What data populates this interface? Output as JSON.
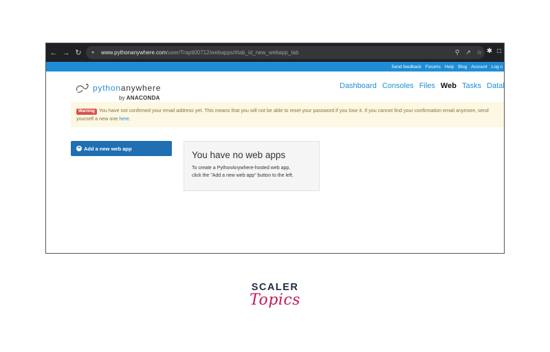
{
  "browser": {
    "url_host": "www.pythonanywhere.com",
    "url_path": "/user/Trapti00712/webapps/#tab_id_new_webapp_tab",
    "nav_icons": [
      "back-arrow-icon",
      "forward-arrow-icon",
      "reload-icon"
    ],
    "omnibox_icons": [
      "zoom-icon",
      "share-icon",
      "bookmark-star-icon"
    ],
    "extension_icons": [
      "puzzle-icon",
      "sidebar-icon"
    ]
  },
  "topbar": {
    "links": [
      "Send feedback",
      "Forums",
      "Help",
      "Blog",
      "Account",
      "Log o"
    ]
  },
  "logo": {
    "part1": "python",
    "part2": "anywhere",
    "by": "by",
    "company": "ANACONDA"
  },
  "nav": {
    "items": [
      "Dashboard",
      "Consoles",
      "Files",
      "Web",
      "Tasks",
      "Databases"
    ],
    "active": "Web"
  },
  "warning": {
    "badge": "Warning",
    "text": "You have not confirmed your email address yet. This means that you will not be able to reset your password if you lose it. If you cannot find your confirmation email anymore, send yourself a new one ",
    "link": "here",
    "end": "."
  },
  "add_button": {
    "label": "Add a new web app"
  },
  "empty": {
    "title": "You have no web apps",
    "line1": "To create a PythonAnywhere-hosted web app,",
    "line2": "click the \"Add a new web app\" button to the left."
  },
  "brand": {
    "top": "SCALER",
    "bottom": "Topics"
  },
  "colors": {
    "accent": "#1f8dd6",
    "button": "#1f6fb2",
    "warning_bg": "#fcf8e3",
    "warning_badge": "#d9534f",
    "brand_pink": "#c2185b"
  }
}
